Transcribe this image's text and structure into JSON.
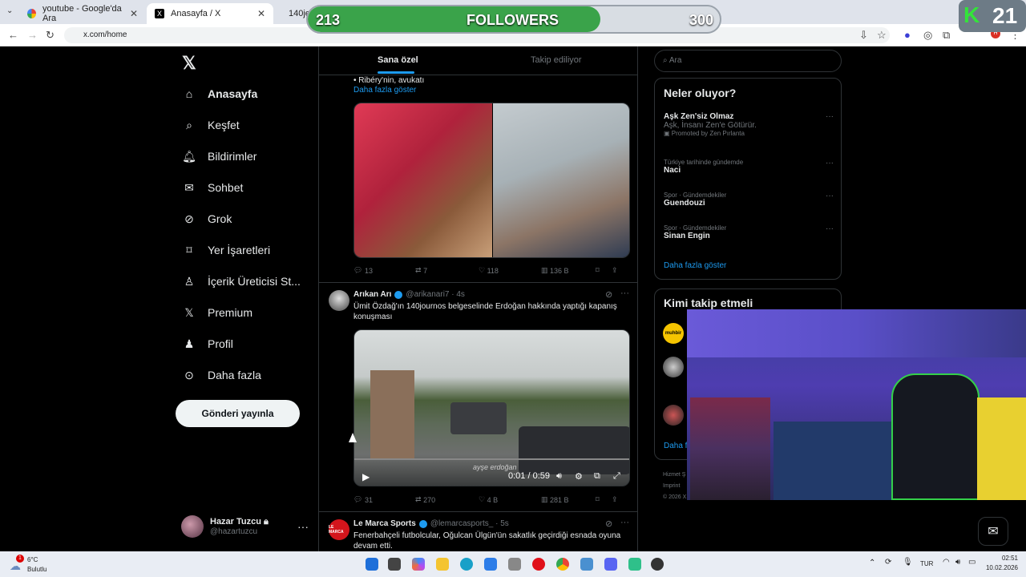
{
  "browser": {
    "tabs": [
      {
        "label": "youtube - Google'da Ara"
      },
      {
        "label": "Anasayfa / X"
      },
      {
        "label": "140je"
      }
    ],
    "url": "x.com/home"
  },
  "overlay": {
    "current": "213",
    "label": "FOLLOWERS",
    "goal": "300",
    "progress": 0.71
  },
  "badge": {
    "letter": "K",
    "number": "21"
  },
  "nav": {
    "items": [
      {
        "label": "Anasayfa"
      },
      {
        "label": "Keşfet"
      },
      {
        "label": "Bildirimler"
      },
      {
        "label": "Sohbet"
      },
      {
        "label": "Grok"
      },
      {
        "label": "Yer İşaretleri"
      },
      {
        "label": "İçerik Üreticisi St..."
      },
      {
        "label": "Premium"
      },
      {
        "label": "Profil"
      },
      {
        "label": "Daha fazla"
      }
    ],
    "post_button": "Gönderi yayınla",
    "profile": {
      "name": "Hazar Tuzcu",
      "handle": "@hazartuzcu"
    }
  },
  "timeline": {
    "tabs": [
      "Sana özel",
      "Takip ediliyor"
    ],
    "tweet1": {
      "text_tail": "• Ribéry'nin, avukatı",
      "show_more": "Daha fazla göster",
      "replies": "13",
      "reposts": "7",
      "likes": "118",
      "views": "136 B"
    },
    "tweet2": {
      "name": "Arıkan Arı",
      "handle": "@arikanari7",
      "time": "· 4s",
      "text": "Ümit Özdağ'ın 140journos belgeselinde Erdoğan hakkında yaptığı kapanış konuşması",
      "video_time": "0:01 / 0:59",
      "watermark": "ayşe erdoğan",
      "replies": "31",
      "reposts": "270",
      "likes": "4 B",
      "views": "281 B"
    },
    "tweet3": {
      "name": "Le Marca Sports",
      "handle": "@lemarcasports_",
      "time": "· 5s",
      "avatar_text": "LE MARCA",
      "text": "Fenerbahçeli futbolcular, Oğulcan Ülgün'ün sakatlık geçirdiği esnada oyuna devam etti."
    }
  },
  "right": {
    "search_placeholder": "Ara",
    "trending_title": "Neler oluyor?",
    "trends": [
      {
        "category": "",
        "title": "Aşk Zen'siz Olmaz",
        "sub": "Aşk, İnsanı Zen'e Götürür.",
        "promo": "Promoted by Zen Pırlanta"
      },
      {
        "category": "Türkiye tarihinde gündemde",
        "title": "Naci"
      },
      {
        "category": "Spor · Gündemdekiler",
        "title": "Guendouzi"
      },
      {
        "category": "Spor · Gündemdekiler",
        "title": "Sinan Engin"
      }
    ],
    "show_more": "Daha fazla göster",
    "who_to_follow": "Kimi takip etmeli",
    "wtf_first_avatar": "muhbir",
    "wtf_more": "Daha f",
    "footer": [
      "Hizmet Ş",
      "Imprint",
      "© 2026 X"
    ]
  },
  "taskbar": {
    "weather_temp": "6°C",
    "weather_desc": "Bulutlu",
    "weather_badge": "1",
    "lang": "TUR",
    "time": "02:51",
    "date": "10.02.2026"
  }
}
